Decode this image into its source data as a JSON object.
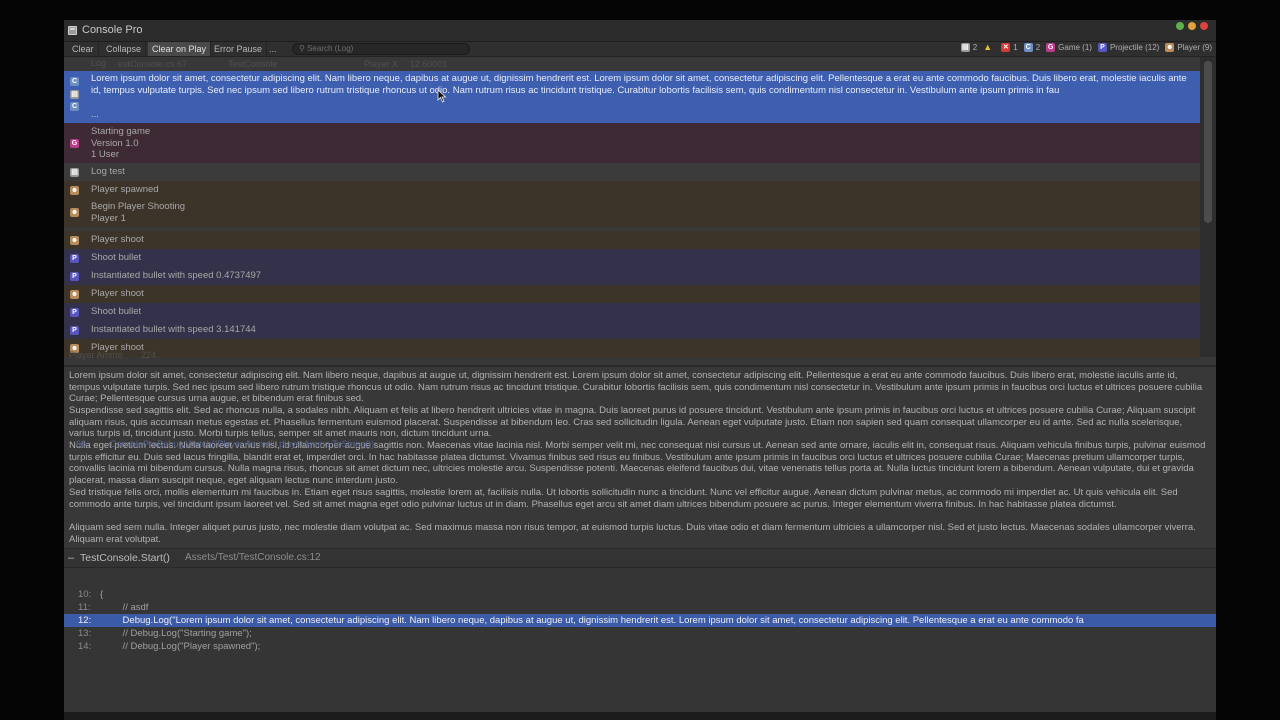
{
  "window": {
    "title": "Console Pro",
    "controls": [
      "#5fb04a",
      "#e2a23a",
      "#d9443d"
    ]
  },
  "toolbar": {
    "clear": "Clear",
    "collapse": "Collapse",
    "clear_on_play": "Clear on Play",
    "error_pause": "Error Pause",
    "more": "...",
    "search_placeholder": "Search (Log)",
    "filters": [
      {
        "icon": "log-icon",
        "label": "2",
        "color": "#9a9a9a"
      },
      {
        "icon": "warning-icon",
        "label": "",
        "color": "#e6c02e"
      },
      {
        "icon": "error-icon",
        "label": "1",
        "color": "#d43b35"
      },
      {
        "icon": "info-icon",
        "label": "2",
        "color": "#6f8fc4"
      },
      {
        "icon": "game-icon",
        "label": "Game (1)",
        "color": "#c03a8a"
      },
      {
        "icon": "projectile-icon",
        "label": "Projectile (12)",
        "color": "#5a56c0"
      },
      {
        "icon": "player-icon",
        "label": "Player (9)",
        "color": "#b88b5c"
      }
    ]
  },
  "ghost_watch": {
    "log": "Log",
    "file": "estConsole.cs 67",
    "test_console": "TestConsole",
    "player_x": "Player X",
    "player_x_val": "12.60001",
    "ammo": "Player Ammo",
    "ammo_val": "224",
    "debug_call": "ConsoleProDebug.Watch(\"Player Ammo\", playerAmmo.ToString());",
    "debug_line": "68"
  },
  "logs": [
    {
      "type": "info",
      "icon": "info-icon",
      "text": "Lorem ipsum dolor sit amet, consectetur adipiscing elit. Nam libero neque, dapibus at augue ut, dignissim hendrerit est. Lorem ipsum dolor sit amet, consectetur adipiscing elit. Pellentesque a erat eu ante commodo faucibus. Duis libero erat, molestie iaculis ante id, tempus vulputate turpis. Sed nec ipsum sed libero rutrum tristique rhoncus ut odio. Nam rutrum risus ac tincidunt tristique. Curabitur lobortis facilisis sem, quis condimentum nisl consectetur in. Vestibulum ante ipsum primis in fau",
      "extra": "..."
    },
    {
      "type": "game",
      "icon": "game-icon",
      "text": "Starting game\nVersion 1.0\n1 User"
    },
    {
      "type": "log",
      "icon": "log-icon",
      "text": "Log test"
    },
    {
      "type": "player",
      "icon": "player-icon",
      "text": "Player spawned"
    },
    {
      "type": "player",
      "icon": "player-icon",
      "text": "Begin Player Shooting\nPlayer 1"
    },
    {
      "type": "player",
      "icon": "player-icon",
      "text": "Player shoot"
    },
    {
      "type": "projectile",
      "icon": "projectile-icon",
      "text": "Shoot bullet"
    },
    {
      "type": "projectile",
      "icon": "projectile-icon",
      "text": "Instantiated bullet with speed 0.4737497"
    },
    {
      "type": "player",
      "icon": "player-icon",
      "text": "Player shoot"
    },
    {
      "type": "projectile",
      "icon": "projectile-icon",
      "text": "Shoot bullet"
    },
    {
      "type": "projectile",
      "icon": "projectile-icon",
      "text": "Instantiated bullet with speed 3.141744"
    },
    {
      "type": "player",
      "icon": "player-icon",
      "text": "Player shoot"
    }
  ],
  "detail": {
    "p1": "Lorem ipsum dolor sit amet, consectetur adipiscing elit. Nam libero neque, dapibus at augue ut, dignissim hendrerit est. Lorem ipsum dolor sit amet, consectetur adipiscing elit. Pellentesque a erat eu ante commodo faucibus. Duis libero erat, molestie iaculis ante id, tempus vulputate turpis. Sed nec ipsum sed libero rutrum tristique rhoncus ut odio. Nam rutrum risus ac tincidunt tristique. Curabitur lobortis facilisis sem, quis condimentum nisl consectetur in. Vestibulum ante ipsum primis in faucibus orci luctus et ultrices posuere cubilia Curae; Pellentesque cursus urna augue, et bibendum erat finibus sed.",
    "p2": "Suspendisse sed sagittis elit. Sed ac rhoncus nulla, a sodales nibh. Aliquam et felis at libero hendrerit ultricies vitae in magna. Duis laoreet purus id posuere tincidunt. Vestibulum ante ipsum primis in faucibus orci luctus et ultrices posuere cubilia Curae; Aliquam suscipit aliquam risus, quis accumsan metus egestas et. Phasellus fermentum euismod placerat. Suspendisse at bibendum leo. Cras sed sollicitudin ligula. Aenean eget vulputate justo. Etiam non sapien sed quam consequat ullamcorper eu id ante. Sed ac nulla scelerisque, varius turpis id, tincidunt justo. Morbi turpis tellus, semper sit amet mauris non, dictum tincidunt urna.",
    "p3": "Nulla eget pretium lectus. Nulla laoreet varius nisl, id ullamcorper augue sagittis non. Maecenas vitae lacinia nisl. Morbi semper velit mi, nec consequat nisi cursus ut. Aenean sed ante ornare, iaculis elit in, consequat risus. Aliquam vehicula finibus turpis, pulvinar euismod turpis efficitur eu. Duis sed lacus fringilla, blandit erat et, imperdiet orci. In hac habitasse platea dictumst. Vivamus finibus sed risus eu finibus. Vestibulum ante ipsum primis in faucibus orci luctus et ultrices posuere cubilia Curae; Maecenas pretium ullamcorper turpis, convallis lacinia mi bibendum cursus. Nulla magna risus, rhoncus sit amet dictum nec, ultricies molestie arcu. Suspendisse potenti. Maecenas eleifend faucibus dui, vitae venenatis tellus porta at. Nulla luctus tincidunt lorem a bibendum. Aenean vulputate, dui et gravida placerat, massa diam suscipit neque, eget aliquam lectus nunc interdum justo.",
    "p4": "Sed tristique felis orci, mollis elementum mi faucibus in. Etiam eget risus sagittis, molestie lorem at, facilisis nulla. Ut lobortis sollicitudin nunc a tincidunt. Nunc vel efficitur augue. Aenean dictum pulvinar metus, ac commodo mi imperdiet ac. Ut quis vehicula elit. Sed commodo ante turpis, vel tincidunt ipsum laoreet vel. Sed sit amet magna eget odio pulvinar luctus ut in diam. Phasellus eget arcu sit amet diam ultrices bibendum posuere ac purus. Integer elementum viverra finibus. In hac habitasse platea dictumst.",
    "p5": "Aliquam sed sem nulla. Integer aliquet purus justo, nec molestie diam volutpat ac. Sed maximus massa non risus tempor, at euismod turpis luctus. Duis vitae odio et diam fermentum ultricies a ullamcorper nisl. Sed et justo lectus. Maecenas sodales ullamcorper viverra. Aliquam erat volutpat."
  },
  "stack": {
    "dash": "–",
    "function": "TestConsole.Start()",
    "path": "Assets/Test/TestConsole.cs:12"
  },
  "code": [
    {
      "num": "10:",
      "src": "{"
    },
    {
      "num": "11:",
      "src": "    // asdf"
    },
    {
      "num": "12:",
      "src": "    Debug.Log(\"Lorem ipsum dolor sit amet, consectetur adipiscing elit. Nam libero neque, dapibus at augue ut, dignissim hendrerit est. Lorem ipsum dolor sit amet, consectetur adipiscing elit. Pellentesque a erat eu ante commodo fa",
      "highlight": true
    },
    {
      "num": "13:",
      "src": "    // Debug.Log(\"Starting game\");"
    },
    {
      "num": "14:",
      "src": "    // Debug.Log(\"Player spawned\");"
    }
  ],
  "colors": {
    "info": "#3e5fb0",
    "game": "#3e2a35",
    "log": "#3b3b3b",
    "player": "#3d3429",
    "projectile": "#33324a"
  }
}
